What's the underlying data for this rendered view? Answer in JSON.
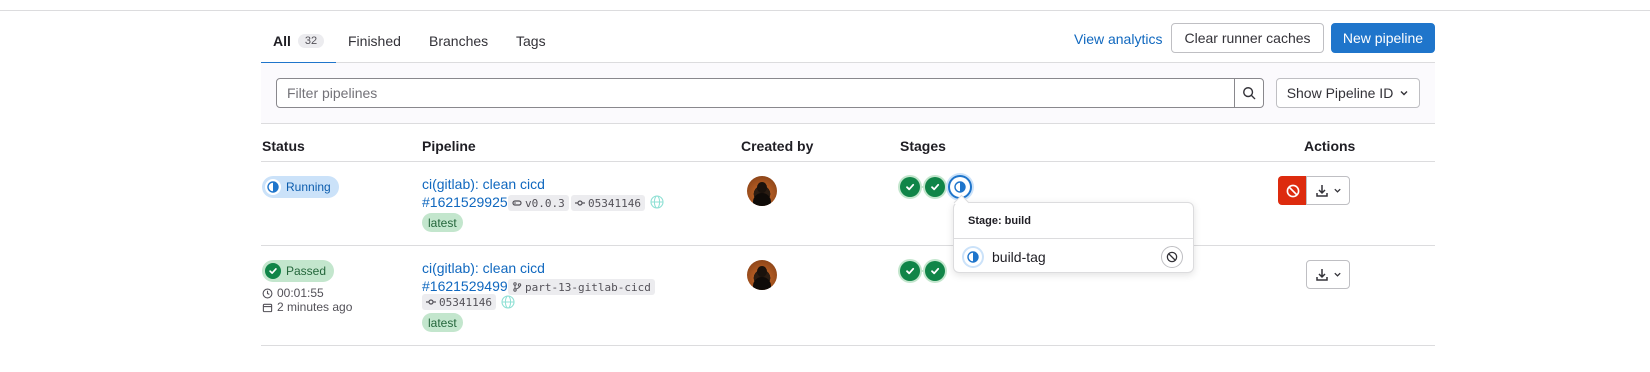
{
  "tabs": [
    {
      "label": "All",
      "count": "32",
      "active": true
    },
    {
      "label": "Finished"
    },
    {
      "label": "Branches"
    },
    {
      "label": "Tags"
    }
  ],
  "header_actions": {
    "view_analytics": "View analytics",
    "clear_caches": "Clear runner caches",
    "new_pipeline": "New pipeline"
  },
  "filter": {
    "placeholder": "Filter pipelines",
    "value": "",
    "show_id_label": "Show Pipeline ID"
  },
  "table": {
    "headers": {
      "status": "Status",
      "pipeline": "Pipeline",
      "created_by": "Created by",
      "stages": "Stages",
      "actions": "Actions"
    },
    "rows": [
      {
        "status": "Running",
        "title": "ci(gitlab): clean cicd",
        "id": "#1621529925",
        "ref": "v0.0.3",
        "commit": "05341146",
        "tag": "latest",
        "stages": [
          "success",
          "success",
          "running"
        ]
      },
      {
        "status": "Passed",
        "duration": "00:01:55",
        "finished": "2 minutes ago",
        "title": "ci(gitlab): clean cicd",
        "id": "#1621529499",
        "ref": "part-13-gitlab-cicd",
        "commit": "05341146",
        "tag": "latest",
        "stages": [
          "success",
          "success"
        ]
      }
    ]
  },
  "stage_popover": {
    "title": "Stage: build",
    "job": "build-tag"
  },
  "colors": {
    "accent": "#1f75cb",
    "link": "#1068bf",
    "success": "#108548",
    "danger": "#dd2b0e"
  }
}
